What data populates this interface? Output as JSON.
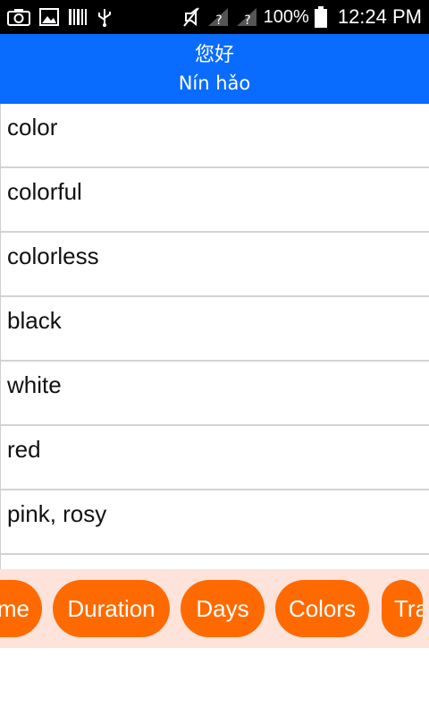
{
  "status_bar": {
    "battery_percent": "100%",
    "time": "12:24 PM",
    "icons": [
      "camera-icon",
      "image-icon",
      "barcode-icon",
      "usb-icon",
      "mute-icon",
      "signal-1-icon",
      "signal-2-icon",
      "battery-icon"
    ]
  },
  "header": {
    "title": "您好",
    "subtitle": "Nín hǎo",
    "background": "#0a6cff"
  },
  "list": {
    "items": [
      "color",
      "colorful",
      "colorless",
      "black",
      "white",
      "red",
      "pink, rosy",
      ""
    ]
  },
  "categories": {
    "items": [
      "Time",
      "Duration",
      "Days",
      "Colors",
      "Transport"
    ],
    "chip_color": "#ff6a00",
    "bar_color": "#fde3d9"
  }
}
